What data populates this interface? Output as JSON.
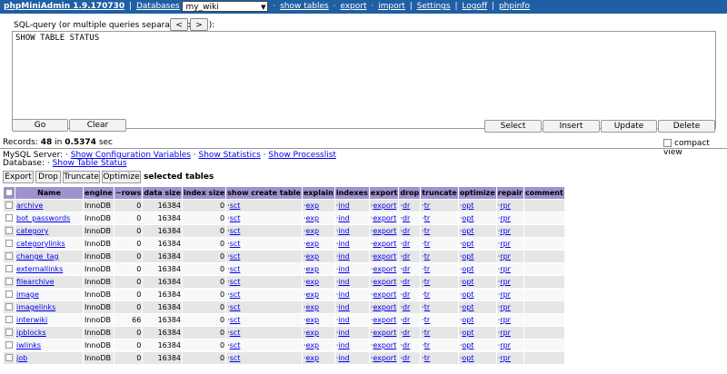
{
  "topbar": {
    "brand": "phpMiniAdmin 1.9.170730",
    "databases_link": "Databases",
    "db_selected": "my_wiki",
    "links": [
      "show tables",
      "export",
      "import",
      "Settings",
      "Logoff",
      "phpinfo"
    ]
  },
  "sql": {
    "label": "SQL-query (or multiple queries separated by \";\"):",
    "prev": "<",
    "next": ">",
    "query": "SHOW TABLE STATUS"
  },
  "buttons": {
    "go": "Go",
    "clear": "Clear",
    "select": "Select",
    "insert": "Insert",
    "update": "Update",
    "delete": "Delete"
  },
  "records": {
    "prefix": "Records:",
    "count": "48",
    "mid": "in",
    "time": "0.5374",
    "suffix": "sec"
  },
  "compact_view": "compact view",
  "server": {
    "label": "MySQL Server:",
    "links": [
      "Show Configuration Variables",
      "Show Statistics",
      "Show Processlist"
    ],
    "db_label": "Database:",
    "db_link": "Show Table Status"
  },
  "table_actions": {
    "export": "Export",
    "drop": "Drop",
    "truncate": "Truncate",
    "optimize": "Optimize",
    "selected": "selected tables"
  },
  "columns": [
    "Name",
    "engine",
    "~rows",
    "data size",
    "index size",
    "show create table",
    "explain",
    "indexes",
    "export",
    "drop",
    "truncate",
    "optimize",
    "repair",
    "comment"
  ],
  "row_links": {
    "sct": "sct",
    "exp": "exp",
    "ind": "ind",
    "export": "export",
    "dr": "dr",
    "tr": "tr",
    "opt": "opt",
    "rpr": "rpr"
  },
  "rows": [
    {
      "name": "archive",
      "engine": "InnoDB",
      "rows": "0",
      "data": "16384",
      "index": "0"
    },
    {
      "name": "bot_passwords",
      "engine": "InnoDB",
      "rows": "0",
      "data": "16384",
      "index": "0"
    },
    {
      "name": "category",
      "engine": "InnoDB",
      "rows": "0",
      "data": "16384",
      "index": "0"
    },
    {
      "name": "categorylinks",
      "engine": "InnoDB",
      "rows": "0",
      "data": "16384",
      "index": "0"
    },
    {
      "name": "change_tag",
      "engine": "InnoDB",
      "rows": "0",
      "data": "16384",
      "index": "0"
    },
    {
      "name": "externallinks",
      "engine": "InnoDB",
      "rows": "0",
      "data": "16384",
      "index": "0"
    },
    {
      "name": "filearchive",
      "engine": "InnoDB",
      "rows": "0",
      "data": "16384",
      "index": "0"
    },
    {
      "name": "image",
      "engine": "InnoDB",
      "rows": "0",
      "data": "16384",
      "index": "0"
    },
    {
      "name": "imagelinks",
      "engine": "InnoDB",
      "rows": "0",
      "data": "16384",
      "index": "0"
    },
    {
      "name": "interwiki",
      "engine": "InnoDB",
      "rows": "66",
      "data": "16384",
      "index": "0"
    },
    {
      "name": "ipblocks",
      "engine": "InnoDB",
      "rows": "0",
      "data": "16384",
      "index": "0"
    },
    {
      "name": "iwlinks",
      "engine": "InnoDB",
      "rows": "0",
      "data": "16384",
      "index": "0"
    },
    {
      "name": "job",
      "engine": "InnoDB",
      "rows": "0",
      "data": "16384",
      "index": "0"
    }
  ]
}
